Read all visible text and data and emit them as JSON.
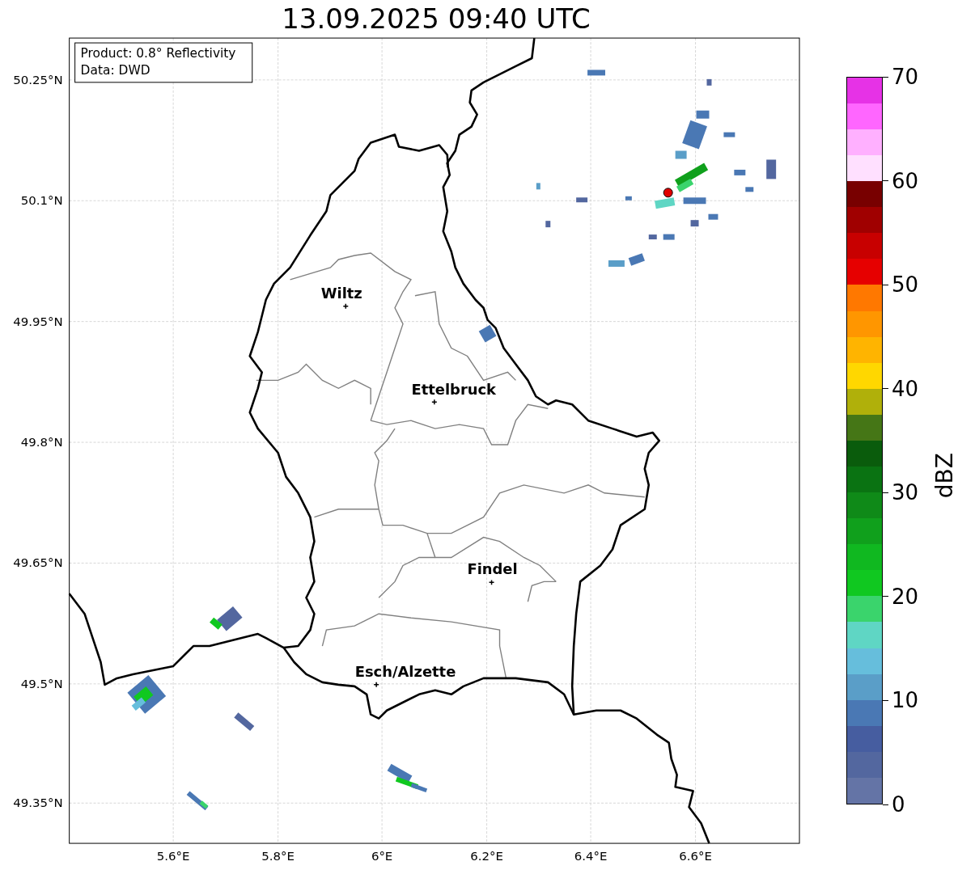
{
  "title": "13.09.2025 09:40 UTC",
  "legend": [
    "Product: 0.8° Reflectivity",
    "Data: DWD"
  ],
  "x_ticks": [
    "5.6°E",
    "5.8°E",
    "6°E",
    "6.2°E",
    "6.4°E",
    "6.6°E"
  ],
  "y_ticks": [
    "50.25°N",
    "50.1°N",
    "49.95°N",
    "49.8°N",
    "49.65°N",
    "49.5°N",
    "49.35°N"
  ],
  "cities": [
    {
      "name": "Wiltz"
    },
    {
      "name": "Ettelbruck"
    },
    {
      "name": "Findel"
    },
    {
      "name": "Esch/Alzette"
    }
  ],
  "colorbar": {
    "label": "dBZ",
    "ticks": [
      "70",
      "60",
      "50",
      "40",
      "30",
      "20",
      "10",
      "0"
    ],
    "bins": [
      {
        "color": "#6474a6"
      },
      {
        "color": "#53679f"
      },
      {
        "color": "#465da0"
      },
      {
        "color": "#4a78b4"
      },
      {
        "color": "#5a9ec8"
      },
      {
        "color": "#66bedc"
      },
      {
        "color": "#5fd6c4"
      },
      {
        "color": "#3ad46c"
      },
      {
        "color": "#10c820"
      },
      {
        "color": "#10b820"
      },
      {
        "color": "#10a01c"
      },
      {
        "color": "#0f8a18"
      },
      {
        "color": "#0a7312"
      },
      {
        "color": "#0a5c0c"
      },
      {
        "color": "#457616"
      },
      {
        "color": "#b0b00a"
      },
      {
        "color": "#ffd700"
      },
      {
        "color": "#ffb400"
      },
      {
        "color": "#ff9600"
      },
      {
        "color": "#ff7800"
      },
      {
        "color": "#e60000"
      },
      {
        "color": "#c80000"
      },
      {
        "color": "#a00000"
      },
      {
        "color": "#780000"
      },
      {
        "color": "#ffe0ff"
      },
      {
        "color": "#ffb0ff"
      },
      {
        "color": "#ff66ff"
      },
      {
        "color": "#e632e6"
      }
    ]
  }
}
